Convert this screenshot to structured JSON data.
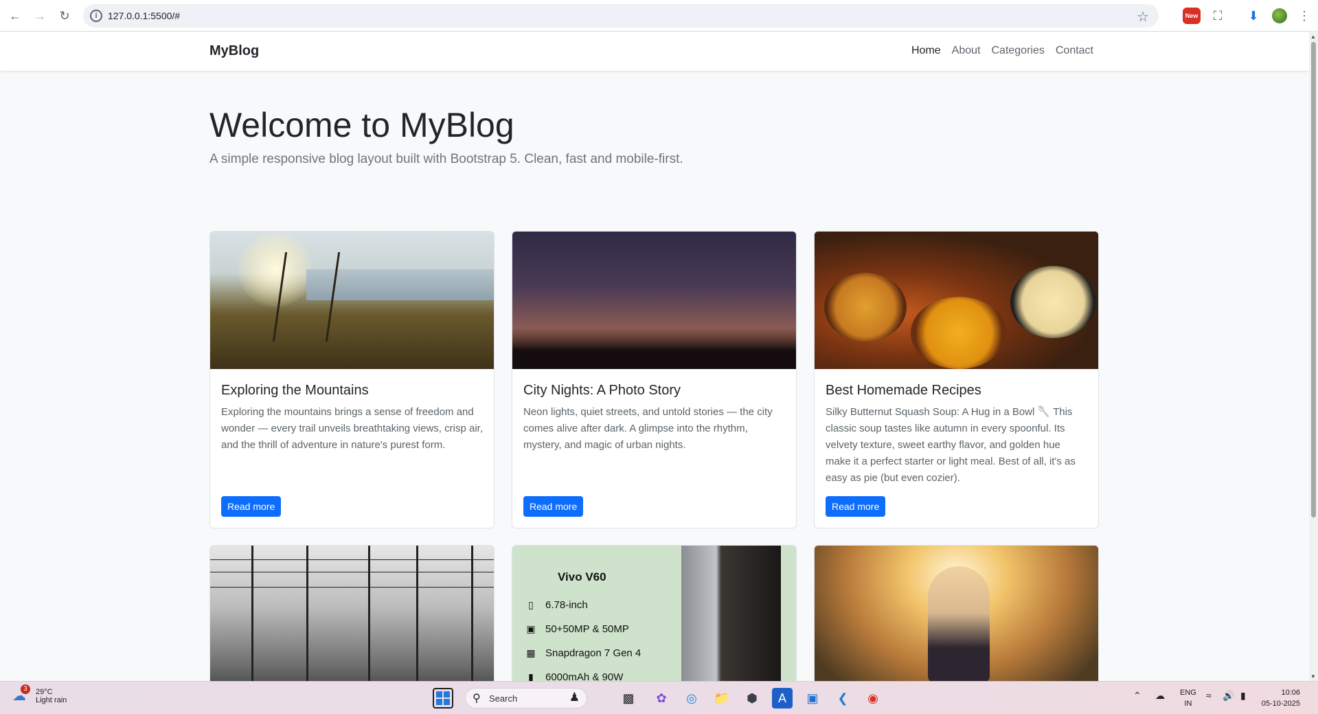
{
  "browser": {
    "url": "127.0.0.1:5500/#",
    "new_badge": "New"
  },
  "site": {
    "brand": "MyBlog",
    "nav": [
      {
        "label": "Home",
        "active": true
      },
      {
        "label": "About",
        "active": false
      },
      {
        "label": "Categories",
        "active": false
      },
      {
        "label": "Contact",
        "active": false
      }
    ],
    "hero": {
      "title": "Welcome to MyBlog",
      "subtitle": "A simple responsive blog layout built with Bootstrap 5. Clean, fast and mobile-first."
    },
    "cards": [
      {
        "title": "Exploring the Mountains",
        "text": "Exploring the mountains brings a sense of freedom and wonder — every trail unveils breathtaking views, crisp air, and the thrill of adventure in nature's purest form.",
        "button": "Read more"
      },
      {
        "title": "City Nights: A Photo Story",
        "text": "Neon lights, quiet streets, and untold stories — the city comes alive after dark. A glimpse into the rhythm, mystery, and magic of urban nights.",
        "button": "Read more"
      },
      {
        "title": "Best Homemade Recipes",
        "text": "Silky Butternut Squash Soup: A Hug in a Bowl 🥄 This classic soup tastes like autumn in every spoonful. Its velvety texture, sweet earthy flavor, and golden hue make it a perfect starter or light meal. Best of all, it's as easy as pie (but even cozier).",
        "button": "Read more"
      }
    ],
    "phone_ad": {
      "title": "Vivo V60",
      "specs": [
        "6.78-inch",
        "50+50MP & 50MP",
        "Snapdragon 7 Gen 4",
        "6000mAh & 90W"
      ]
    }
  },
  "taskbar": {
    "weather_badge": "3",
    "temperature": "29°C",
    "condition": "Light rain",
    "search_label": "Search",
    "lang_line1": "ENG",
    "lang_line2": "IN",
    "time": "10:06",
    "date": "05-10-2025"
  },
  "colors": {
    "primary": "#0d6efd",
    "page_bg": "#f8f9fa"
  }
}
